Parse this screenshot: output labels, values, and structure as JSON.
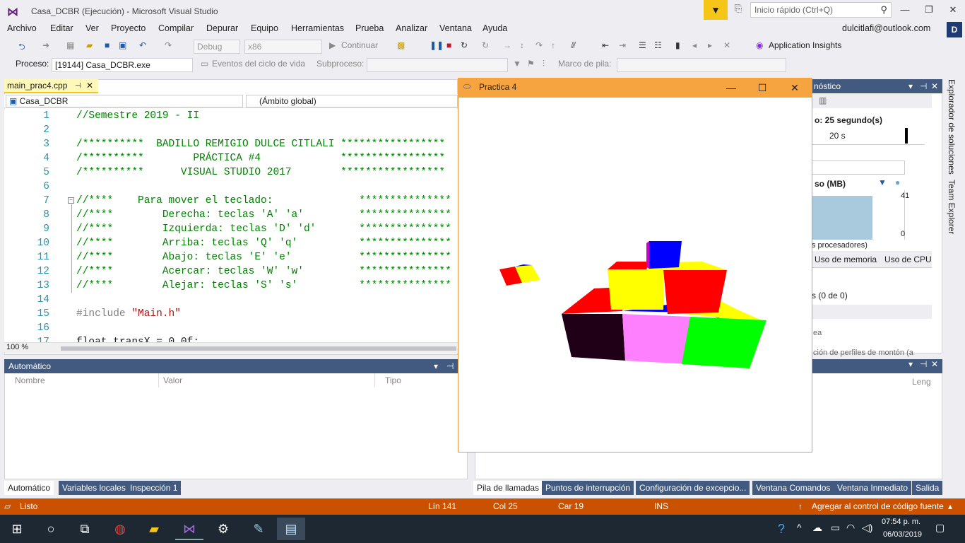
{
  "titlebar": {
    "title": "Casa_DCBR (Ejecución) - Microsoft Visual Studio",
    "quick_launch_placeholder": "Inicio rápido (Ctrl+Q)"
  },
  "menu": [
    "Archivo",
    "Editar",
    "Ver",
    "Proyecto",
    "Compilar",
    "Depurar",
    "Equipo",
    "Herramientas",
    "Prueba",
    "Analizar",
    "Ventana",
    "Ayuda"
  ],
  "account": {
    "email": "dulcitlafi@outlook.com",
    "initial": "D"
  },
  "toolbar": {
    "config": "Debug",
    "platform": "x86",
    "continue_label": "Continuar",
    "insights": "Application Insights"
  },
  "toolbar2": {
    "process_label": "Proceso:",
    "process_value": "[19144] Casa_DCBR.exe",
    "lifecycle": "Eventos del ciclo de vida",
    "thread_label": "Subproceso:",
    "stack_label": "Marco de pila:"
  },
  "editor": {
    "tab": "main_prac4.cpp",
    "project_scope": "Casa_DCBR",
    "global_scope": "(Ámbito global)",
    "zoom": "100 %",
    "lines": [
      {
        "n": "1",
        "t": "//Semestre 2019 - II",
        "c": "cmt"
      },
      {
        "n": "2",
        "t": "",
        "c": "cmt"
      },
      {
        "n": "3",
        "t": "/**********  BADILLO REMIGIO DULCE CITLALI *****************",
        "c": "cmt"
      },
      {
        "n": "4",
        "t": "/**********        PRÁCTICA #4             *****************",
        "c": "cmt"
      },
      {
        "n": "5",
        "t": "/**********      VISUAL STUDIO 2017        *****************",
        "c": "cmt"
      },
      {
        "n": "6",
        "t": "",
        "c": "cmt"
      },
      {
        "n": "7",
        "t": "//****    Para mover el teclado:              ***************",
        "c": "cmt"
      },
      {
        "n": "8",
        "t": "//****        Derecha: teclas 'A' 'a'         ***************",
        "c": "cmt"
      },
      {
        "n": "9",
        "t": "//****        Izquierda: teclas 'D' 'd'       ***************",
        "c": "cmt"
      },
      {
        "n": "10",
        "t": "//****        Arriba: teclas 'Q' 'q'          ***************",
        "c": "cmt"
      },
      {
        "n": "11",
        "t": "//****        Abajo: teclas 'E' 'e'           ***************",
        "c": "cmt"
      },
      {
        "n": "12",
        "t": "//****        Acercar: teclas 'W' 'w'         ***************",
        "c": "cmt"
      },
      {
        "n": "13",
        "t": "//****        Alejar: teclas 'S' 's'          ***************",
        "c": "cmt"
      },
      {
        "n": "14",
        "t": "",
        "c": "cmt"
      },
      {
        "n": "15",
        "t": "#include ",
        "c": "pp",
        "s": "\"Main.h\""
      },
      {
        "n": "16",
        "t": "",
        "c": "cmt"
      },
      {
        "n": "17",
        "t": "float transX = 0.0f;",
        "c": ""
      }
    ]
  },
  "auto_panel": {
    "title": "Automático",
    "cols": [
      "Nombre",
      "Valor",
      "Tipo"
    ],
    "tabs": [
      "Automático",
      "Variables locales",
      "Inspección 1"
    ]
  },
  "diag_panel": {
    "title": "nóstico",
    "session": "o: 25 segundo(s)",
    "timeline": "20 s",
    "mem_label": "so (MB)",
    "mem_max": "41",
    "mem_min": "0",
    "proc_label": "s procesadores)",
    "tab_mem": "Uso de memoria",
    "tab_cpu": "Uso de CPU",
    "events": "s (0 de 0)",
    "link1": "ea",
    "link2": "ción de perfiles de montón (a"
  },
  "bottom_right": {
    "col": "Leng",
    "tabs": [
      "Pila de llamadas",
      "Puntos de interrupción",
      "Configuración de excepcio...",
      "Ventana Comandos",
      "Ventana Inmediato",
      "Salida"
    ]
  },
  "side_tabs": [
    "Explorador de soluciones",
    "Team Explorer"
  ],
  "status": {
    "ready": "Listo",
    "line": "Lín 141",
    "col": "Col 25",
    "car": "Car 19",
    "ins": "INS",
    "scc": "Agregar al control de código fuente"
  },
  "gl_window": {
    "title": "Practica 4"
  },
  "taskbar": {
    "time": "07:54 p. m.",
    "date": "06/03/2019"
  },
  "colors": {
    "accent": "#ca5100",
    "panel_header": "#425a7f",
    "gl_title": "#f5a43f"
  }
}
